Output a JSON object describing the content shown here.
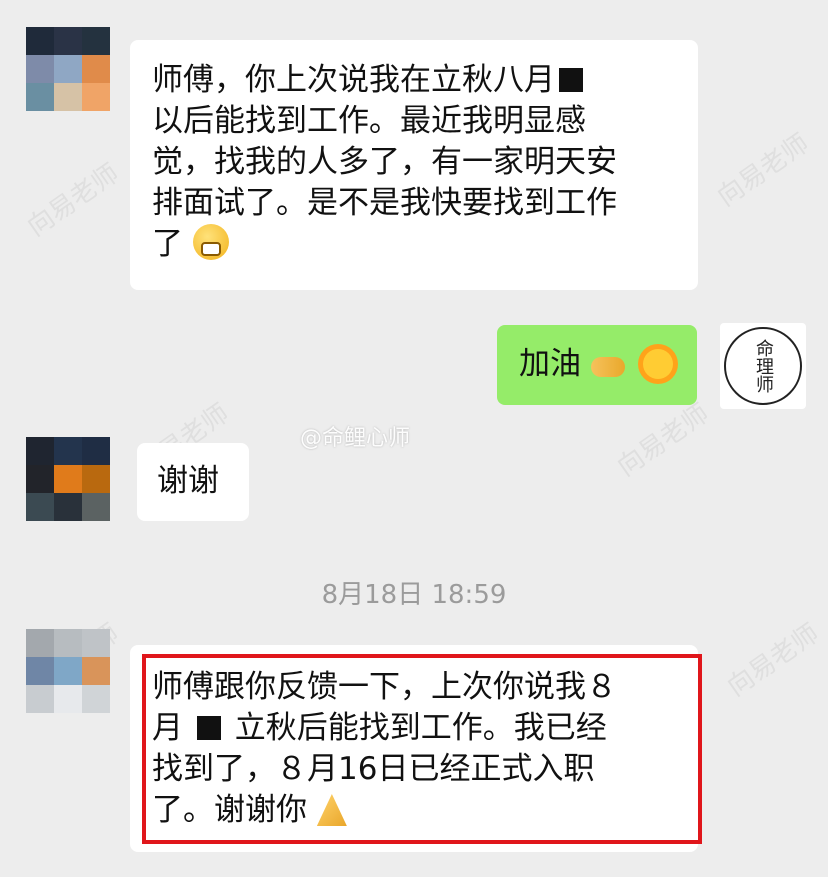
{
  "messages": [
    {
      "id": "m1",
      "lines": [
        "师傅，你上次说我在立秋八月",
        "以后能找到工作。最近我明显感",
        "觉，找我的人多了，有一家明天安",
        "排面试了。是不是我快要找到工作",
        "了"
      ]
    },
    {
      "id": "m2",
      "text": "加油"
    },
    {
      "id": "m3",
      "text": "谢谢"
    },
    {
      "id": "m4",
      "lines": [
        "师傅跟你反馈一下，上次你说我８",
        "月",
        "立秋后能找到工作。我已经",
        "找到了，８月16日已经正式入职",
        "了。谢谢你"
      ]
    }
  ],
  "timestamp": "8月18日 18:59",
  "weibo_watermark": "@命鲤心师",
  "side_watermark": "向易老师",
  "seal_text": "命理师",
  "icons": [
    "grinning-emoji-icon",
    "handshake-emoji-icon",
    "sun-emoji-icon",
    "pray-emoji-icon"
  ]
}
